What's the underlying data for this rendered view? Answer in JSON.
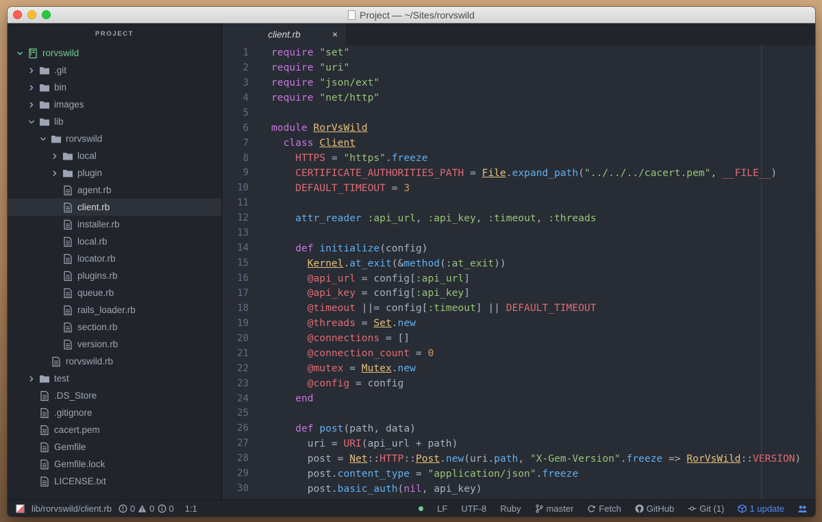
{
  "window": {
    "title": "Project — ~/Sites/rorvswild"
  },
  "sidebar": {
    "header": "PROJECT",
    "items": [
      {
        "label": "rorvswild",
        "depth": 0,
        "kind": "repo",
        "expanded": true
      },
      {
        "label": ".git",
        "depth": 1,
        "kind": "folder",
        "expanded": false
      },
      {
        "label": "bin",
        "depth": 1,
        "kind": "folder",
        "expanded": false
      },
      {
        "label": "images",
        "depth": 1,
        "kind": "folder",
        "expanded": false
      },
      {
        "label": "lib",
        "depth": 1,
        "kind": "folder",
        "expanded": true
      },
      {
        "label": "rorvswild",
        "depth": 2,
        "kind": "folder",
        "expanded": true
      },
      {
        "label": "local",
        "depth": 3,
        "kind": "folder",
        "expanded": false
      },
      {
        "label": "plugin",
        "depth": 3,
        "kind": "folder",
        "expanded": false
      },
      {
        "label": "agent.rb",
        "depth": 3,
        "kind": "file"
      },
      {
        "label": "client.rb",
        "depth": 3,
        "kind": "file",
        "selected": true
      },
      {
        "label": "installer.rb",
        "depth": 3,
        "kind": "file"
      },
      {
        "label": "local.rb",
        "depth": 3,
        "kind": "file"
      },
      {
        "label": "locator.rb",
        "depth": 3,
        "kind": "file"
      },
      {
        "label": "plugins.rb",
        "depth": 3,
        "kind": "file"
      },
      {
        "label": "queue.rb",
        "depth": 3,
        "kind": "file"
      },
      {
        "label": "rails_loader.rb",
        "depth": 3,
        "kind": "file"
      },
      {
        "label": "section.rb",
        "depth": 3,
        "kind": "file"
      },
      {
        "label": "version.rb",
        "depth": 3,
        "kind": "file"
      },
      {
        "label": "rorvswild.rb",
        "depth": 2,
        "kind": "file"
      },
      {
        "label": "test",
        "depth": 1,
        "kind": "folder",
        "expanded": false
      },
      {
        "label": ".DS_Store",
        "depth": 1,
        "kind": "file"
      },
      {
        "label": ".gitignore",
        "depth": 1,
        "kind": "file"
      },
      {
        "label": "cacert.pem",
        "depth": 1,
        "kind": "file"
      },
      {
        "label": "Gemfile",
        "depth": 1,
        "kind": "file"
      },
      {
        "label": "Gemfile.lock",
        "depth": 1,
        "kind": "file"
      },
      {
        "label": "LICENSE.txt",
        "depth": 1,
        "kind": "file"
      }
    ]
  },
  "tabs": [
    {
      "label": "client.rb",
      "close": "×"
    }
  ],
  "code": {
    "lines": [
      [
        [
          "kw",
          "require"
        ],
        [
          "p",
          " "
        ],
        [
          "str",
          "\"set\""
        ]
      ],
      [
        [
          "kw",
          "require"
        ],
        [
          "p",
          " "
        ],
        [
          "str",
          "\"uri\""
        ]
      ],
      [
        [
          "kw",
          "require"
        ],
        [
          "p",
          " "
        ],
        [
          "str",
          "\"json/ext\""
        ]
      ],
      [
        [
          "kw",
          "require"
        ],
        [
          "p",
          " "
        ],
        [
          "str",
          "\"net/http\""
        ]
      ],
      [],
      [
        [
          "kw",
          "module"
        ],
        [
          "p",
          " "
        ],
        [
          "const",
          "RorVsWild"
        ]
      ],
      [
        [
          "p",
          "  "
        ],
        [
          "kw",
          "class"
        ],
        [
          "p",
          " "
        ],
        [
          "const",
          "Client"
        ]
      ],
      [
        [
          "p",
          "    "
        ],
        [
          "cnst",
          "HTTPS"
        ],
        [
          "p",
          " = "
        ],
        [
          "str",
          "\"https\""
        ],
        [
          "p",
          "."
        ],
        [
          "fn",
          "freeze"
        ]
      ],
      [
        [
          "p",
          "    "
        ],
        [
          "cnst",
          "CERTIFICATE_AUTHORITIES_PATH"
        ],
        [
          "p",
          " = "
        ],
        [
          "const",
          "File"
        ],
        [
          "p",
          "."
        ],
        [
          "fn",
          "expand_path"
        ],
        [
          "p",
          "("
        ],
        [
          "str",
          "\"../../../cacert.pem\""
        ],
        [
          "p",
          ", "
        ],
        [
          "cnst",
          "__FILE__"
        ],
        [
          "p",
          ")"
        ]
      ],
      [
        [
          "p",
          "    "
        ],
        [
          "cnst",
          "DEFAULT_TIMEOUT"
        ],
        [
          "p",
          " = "
        ],
        [
          "num",
          "3"
        ]
      ],
      [],
      [
        [
          "p",
          "    "
        ],
        [
          "fn",
          "attr_reader"
        ],
        [
          "p",
          " "
        ],
        [
          "sym",
          ":api_url"
        ],
        [
          "p",
          ", "
        ],
        [
          "sym",
          ":api_key"
        ],
        [
          "p",
          ", "
        ],
        [
          "sym",
          ":timeout"
        ],
        [
          "p",
          ", "
        ],
        [
          "sym",
          ":threads"
        ]
      ],
      [],
      [
        [
          "p",
          "    "
        ],
        [
          "kw",
          "def"
        ],
        [
          "p",
          " "
        ],
        [
          "fn",
          "initialize"
        ],
        [
          "p",
          "(config)"
        ]
      ],
      [
        [
          "p",
          "      "
        ],
        [
          "const",
          "Kernel"
        ],
        [
          "p",
          "."
        ],
        [
          "fn",
          "at_exit"
        ],
        [
          "p",
          "(&"
        ],
        [
          "fn",
          "method"
        ],
        [
          "p",
          "("
        ],
        [
          "sym",
          ":at_exit"
        ],
        [
          "p",
          "))"
        ]
      ],
      [
        [
          "p",
          "      "
        ],
        [
          "ivar",
          "@api_url"
        ],
        [
          "p",
          " = config["
        ],
        [
          "sym",
          ":api_url"
        ],
        [
          "p",
          "]"
        ]
      ],
      [
        [
          "p",
          "      "
        ],
        [
          "ivar",
          "@api_key"
        ],
        [
          "p",
          " = config["
        ],
        [
          "sym",
          ":api_key"
        ],
        [
          "p",
          "]"
        ]
      ],
      [
        [
          "p",
          "      "
        ],
        [
          "ivar",
          "@timeout"
        ],
        [
          "p",
          " ||= config["
        ],
        [
          "sym",
          ":timeout"
        ],
        [
          "p",
          "] || "
        ],
        [
          "cnst",
          "DEFAULT_TIMEOUT"
        ]
      ],
      [
        [
          "p",
          "      "
        ],
        [
          "ivar",
          "@threads"
        ],
        [
          "p",
          " = "
        ],
        [
          "const",
          "Set"
        ],
        [
          "p",
          "."
        ],
        [
          "fn",
          "new"
        ]
      ],
      [
        [
          "p",
          "      "
        ],
        [
          "ivar",
          "@connections"
        ],
        [
          "p",
          " = []"
        ]
      ],
      [
        [
          "p",
          "      "
        ],
        [
          "ivar",
          "@connection_count"
        ],
        [
          "p",
          " = "
        ],
        [
          "num",
          "0"
        ]
      ],
      [
        [
          "p",
          "      "
        ],
        [
          "ivar",
          "@mutex"
        ],
        [
          "p",
          " = "
        ],
        [
          "const",
          "Mutex"
        ],
        [
          "p",
          "."
        ],
        [
          "fn",
          "new"
        ]
      ],
      [
        [
          "p",
          "      "
        ],
        [
          "ivar",
          "@config"
        ],
        [
          "p",
          " = config"
        ]
      ],
      [
        [
          "p",
          "    "
        ],
        [
          "kw",
          "end"
        ]
      ],
      [],
      [
        [
          "p",
          "    "
        ],
        [
          "kw",
          "def"
        ],
        [
          "p",
          " "
        ],
        [
          "fn",
          "post"
        ],
        [
          "p",
          "(path, data)"
        ]
      ],
      [
        [
          "p",
          "      uri = "
        ],
        [
          "mod",
          "URI"
        ],
        [
          "p",
          "(api_url + path)"
        ]
      ],
      [
        [
          "p",
          "      post = "
        ],
        [
          "const",
          "Net"
        ],
        [
          "p",
          "::"
        ],
        [
          "cnst",
          "HTTP"
        ],
        [
          "p",
          "::"
        ],
        [
          "const",
          "Post"
        ],
        [
          "p",
          "."
        ],
        [
          "fn",
          "new"
        ],
        [
          "p",
          "(uri."
        ],
        [
          "fn",
          "path"
        ],
        [
          "p",
          ", "
        ],
        [
          "str",
          "\"X-Gem-Version\""
        ],
        [
          "p",
          "."
        ],
        [
          "fn",
          "freeze"
        ],
        [
          "p",
          " => "
        ],
        [
          "const",
          "RorVsWild"
        ],
        [
          "p",
          "::"
        ],
        [
          "cnst",
          "VERSION"
        ],
        [
          "p",
          ")"
        ]
      ],
      [
        [
          "p",
          "      post."
        ],
        [
          "fn",
          "content_type"
        ],
        [
          "p",
          " = "
        ],
        [
          "str",
          "\"application/json\""
        ],
        [
          "p",
          "."
        ],
        [
          "fn",
          "freeze"
        ]
      ],
      [
        [
          "p",
          "      post."
        ],
        [
          "fn",
          "basic_auth"
        ],
        [
          "p",
          "("
        ],
        [
          "kw",
          "nil"
        ],
        [
          "p",
          ", api_key)"
        ]
      ]
    ]
  },
  "status": {
    "path": "lib/rorvswild/client.rb",
    "errors": "0",
    "warnings": "0",
    "infos": "0",
    "cursor": "1:1",
    "line_ending": "LF",
    "encoding": "UTF-8",
    "grammar": "Ruby",
    "branch": "master",
    "fetch": "Fetch",
    "github": "GitHub",
    "git": "Git (1)",
    "update": "1 update"
  }
}
